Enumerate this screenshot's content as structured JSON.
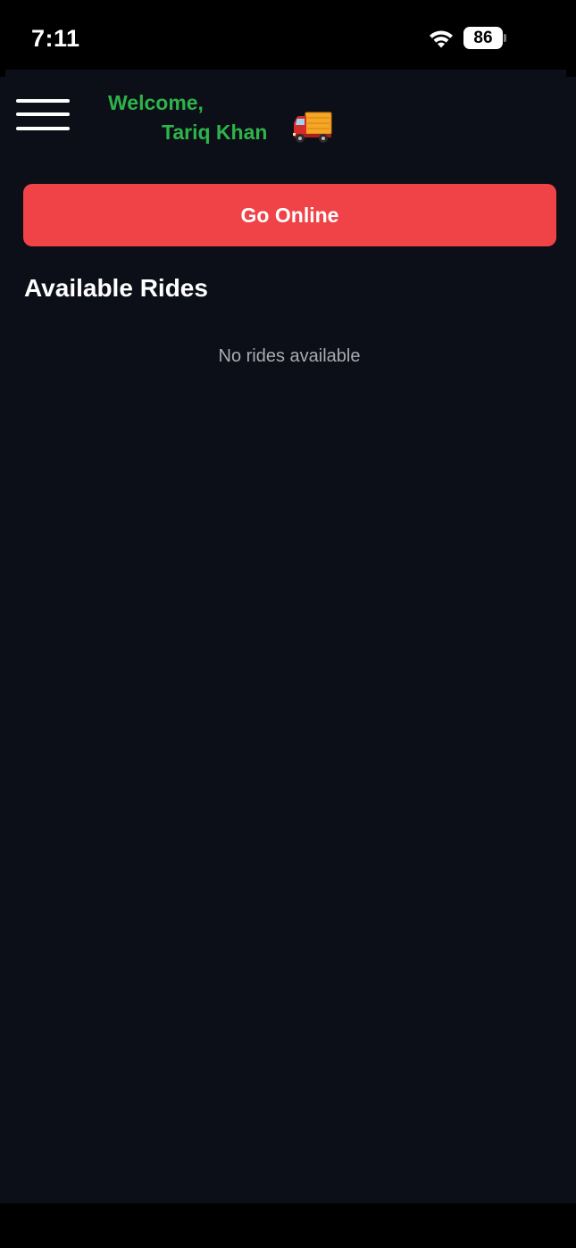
{
  "status_bar": {
    "time": "7:11",
    "battery": "86",
    "wifi_icon": "wifi-icon"
  },
  "header": {
    "menu_icon": "hamburger-menu-icon",
    "welcome": "Welcome,",
    "user_name": "Tariq Khan",
    "truck_icon": "delivery-truck-icon"
  },
  "actions": {
    "go_online_label": "Go Online"
  },
  "rides": {
    "title": "Available Rides",
    "empty_message": "No rides available"
  },
  "colors": {
    "background": "#0c0f17",
    "accent_green": "#2db34a",
    "button_red": "#ef4348",
    "muted_text": "#a8abb2"
  }
}
